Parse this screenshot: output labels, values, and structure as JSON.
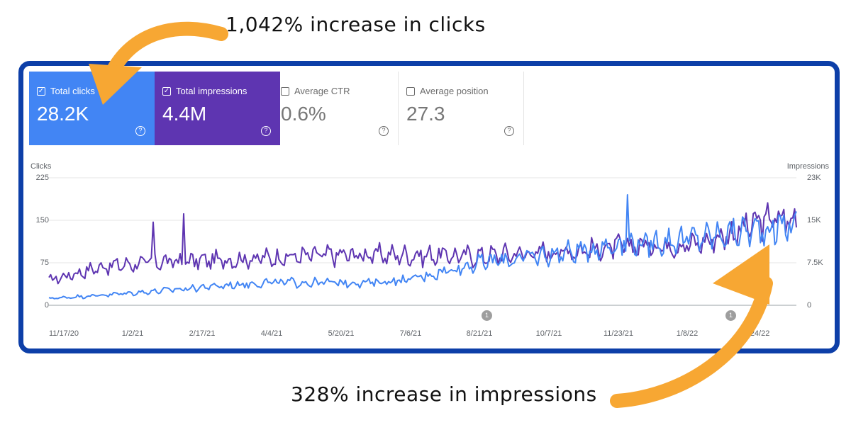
{
  "annotations": {
    "top": "1,042% increase in clicks",
    "bottom": "328% increase in impressions",
    "arrow_color": "#f7a733"
  },
  "metrics": [
    {
      "id": "clicks",
      "label": "Total clicks",
      "value": "28.2K",
      "checked": true,
      "color": "#4285f4"
    },
    {
      "id": "impressions",
      "label": "Total impressions",
      "value": "4.4M",
      "checked": true,
      "color": "#5e35b1"
    },
    {
      "id": "ctr",
      "label": "Average CTR",
      "value": "0.6%",
      "checked": false
    },
    {
      "id": "position",
      "label": "Average position",
      "value": "27.3",
      "checked": false
    }
  ],
  "chart_data": {
    "type": "line",
    "y_left": {
      "label": "Clicks",
      "ticks": [
        "225",
        "150",
        "75",
        "0"
      ],
      "range": [
        0,
        225
      ]
    },
    "y_right": {
      "label": "Impressions",
      "ticks": [
        "23K",
        "15K",
        "7.5K",
        "0"
      ],
      "range": [
        0,
        23000
      ]
    },
    "x_ticks": [
      "11/17/20",
      "1/2/21",
      "2/17/21",
      "4/4/21",
      "5/20/21",
      "7/6/21",
      "8/21/21",
      "10/7/21",
      "11/23/21",
      "1/8/22",
      "2/24/22"
    ],
    "grid": true,
    "series": [
      {
        "name": "Total impressions",
        "color": "#5e35b1",
        "axis": "right",
        "keypoints": [
          [
            0,
            4500
          ],
          [
            30,
            7000
          ],
          [
            60,
            7800
          ],
          [
            90,
            8100
          ],
          [
            120,
            8500
          ],
          [
            150,
            9000
          ],
          [
            180,
            9100
          ],
          [
            210,
            9000
          ],
          [
            240,
            8900
          ],
          [
            270,
            9500
          ],
          [
            300,
            10000
          ],
          [
            330,
            10800
          ],
          [
            360,
            11000
          ],
          [
            380,
            13000
          ],
          [
            400,
            15500
          ],
          [
            416,
            15500
          ]
        ],
        "spikes": [
          [
            58,
            15000
          ],
          [
            75,
            16500
          ]
        ]
      },
      {
        "name": "Total clicks",
        "color": "#4285f4",
        "axis": "left",
        "keypoints": [
          [
            0,
            12
          ],
          [
            30,
            18
          ],
          [
            60,
            25
          ],
          [
            90,
            33
          ],
          [
            120,
            40
          ],
          [
            150,
            40
          ],
          [
            180,
            40
          ],
          [
            200,
            45
          ],
          [
            220,
            60
          ],
          [
            240,
            75
          ],
          [
            260,
            82
          ],
          [
            280,
            90
          ],
          [
            300,
            98
          ],
          [
            320,
            110
          ],
          [
            340,
            112
          ],
          [
            360,
            118
          ],
          [
            380,
            128
          ],
          [
            400,
            135
          ],
          [
            416,
            145
          ]
        ],
        "spikes": [
          [
            322,
            195
          ],
          [
            334,
            85
          ]
        ]
      }
    ],
    "event_markers": [
      "1",
      "1"
    ]
  }
}
